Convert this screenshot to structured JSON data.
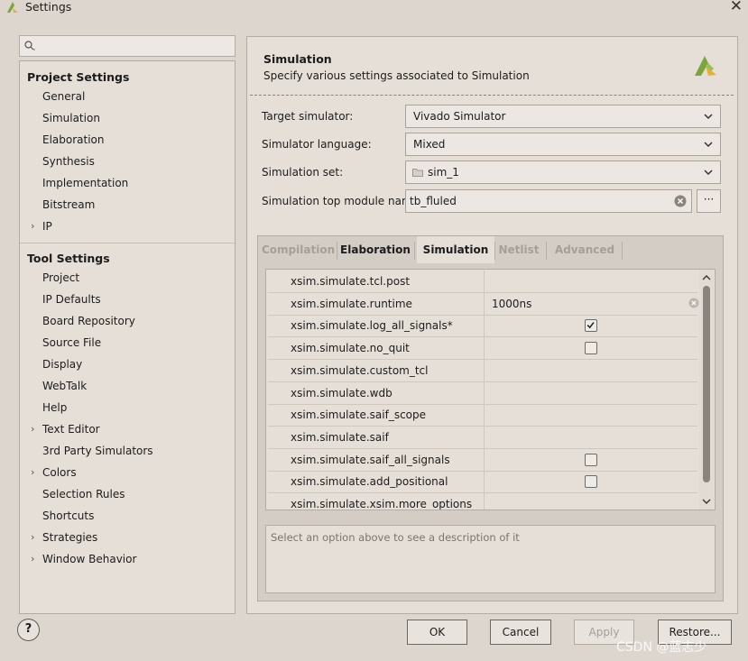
{
  "window": {
    "title": "Settings",
    "close_glyph": "✕"
  },
  "search": {
    "placeholder": ""
  },
  "tree": {
    "project_header": "Project Settings",
    "project_items": [
      {
        "label": "General",
        "expandable": false
      },
      {
        "label": "Simulation",
        "expandable": false
      },
      {
        "label": "Elaboration",
        "expandable": false
      },
      {
        "label": "Synthesis",
        "expandable": false
      },
      {
        "label": "Implementation",
        "expandable": false
      },
      {
        "label": "Bitstream",
        "expandable": false
      },
      {
        "label": "IP",
        "expandable": true
      }
    ],
    "tool_header": "Tool Settings",
    "tool_items": [
      {
        "label": "Project",
        "expandable": false
      },
      {
        "label": "IP Defaults",
        "expandable": false
      },
      {
        "label": "Board Repository",
        "expandable": false
      },
      {
        "label": "Source File",
        "expandable": false
      },
      {
        "label": "Display",
        "expandable": false
      },
      {
        "label": "WebTalk",
        "expandable": false
      },
      {
        "label": "Help",
        "expandable": false
      },
      {
        "label": "Text Editor",
        "expandable": true
      },
      {
        "label": "3rd Party Simulators",
        "expandable": false
      },
      {
        "label": "Colors",
        "expandable": true
      },
      {
        "label": "Selection Rules",
        "expandable": false
      },
      {
        "label": "Shortcuts",
        "expandable": false
      },
      {
        "label": "Strategies",
        "expandable": true
      },
      {
        "label": "Window Behavior",
        "expandable": true
      }
    ],
    "chevron_glyph": "›"
  },
  "page": {
    "title": "Simulation",
    "subtitle": "Specify various settings associated to Simulation"
  },
  "form": {
    "target_simulator_label": "Target simulator:",
    "target_simulator_value": "Vivado Simulator",
    "simulator_language_label": "Simulator language:",
    "simulator_language_value": "Mixed",
    "simulation_set_label": "Simulation set:",
    "simulation_set_value": "sim_1",
    "top_module_label": "Simulation top module name:",
    "top_module_value": "tb_fluled",
    "more_label": "···"
  },
  "tabs": [
    {
      "label": "Compilation",
      "state": "disabled"
    },
    {
      "label": "Elaboration",
      "state": "normal"
    },
    {
      "label": "Simulation",
      "state": "active"
    },
    {
      "label": "Netlist",
      "state": "disabled"
    },
    {
      "label": "Advanced",
      "state": "disabled"
    }
  ],
  "options": [
    {
      "key": "xsim.simulate.tcl.post",
      "value": "",
      "checkbox": null
    },
    {
      "key": "xsim.simulate.runtime",
      "value": "1000ns",
      "checkbox": null,
      "clearable": true
    },
    {
      "key": "xsim.simulate.log_all_signals*",
      "value": "",
      "checkbox": true
    },
    {
      "key": "xsim.simulate.no_quit",
      "value": "",
      "checkbox": false
    },
    {
      "key": "xsim.simulate.custom_tcl",
      "value": "",
      "checkbox": null
    },
    {
      "key": "xsim.simulate.wdb",
      "value": "",
      "checkbox": null
    },
    {
      "key": "xsim.simulate.saif_scope",
      "value": "",
      "checkbox": null
    },
    {
      "key": "xsim.simulate.saif",
      "value": "",
      "checkbox": null
    },
    {
      "key": "xsim.simulate.saif_all_signals",
      "value": "",
      "checkbox": false
    },
    {
      "key": "xsim.simulate.add_positional",
      "value": "",
      "checkbox": false
    },
    {
      "key": "xsim.simulate.xsim.more_options",
      "value": "",
      "checkbox": null
    }
  ],
  "description": {
    "placeholder": "Select an option above to see a description of it"
  },
  "buttons": {
    "help": "?",
    "ok": "OK",
    "cancel": "Cancel",
    "apply": "Apply",
    "restore": "Restore..."
  },
  "watermark": "CSDN @蓝志少",
  "colors": {
    "logo_green": "#7aa63c",
    "logo_yellow": "#e0b23a",
    "background": "#ddd6cf"
  }
}
